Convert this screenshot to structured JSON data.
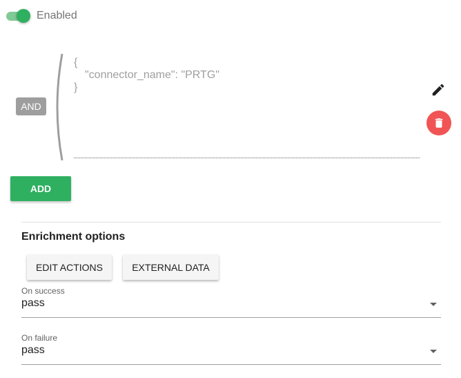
{
  "toggle": {
    "label": "Enabled",
    "on": true
  },
  "rule": {
    "operator": "AND",
    "code_lines": [
      "{",
      "\"connector_name\": \"PRTG\"",
      "}"
    ]
  },
  "add_label": "ADD",
  "enrichment": {
    "title": "Enrichment options",
    "buttons": {
      "edit_actions": "EDIT ACTIONS",
      "external_data": "EXTERNAL DATA"
    }
  },
  "on_success": {
    "label": "On success",
    "value": "pass"
  },
  "on_failure": {
    "label": "On failure",
    "value": "pass"
  },
  "colors": {
    "accent": "#2eb060",
    "danger": "#f05454",
    "badge": "#9e9e9e"
  },
  "icons": {
    "edit": "pencil-icon",
    "delete": "trash-icon",
    "dropdown": "caret-down-icon"
  }
}
